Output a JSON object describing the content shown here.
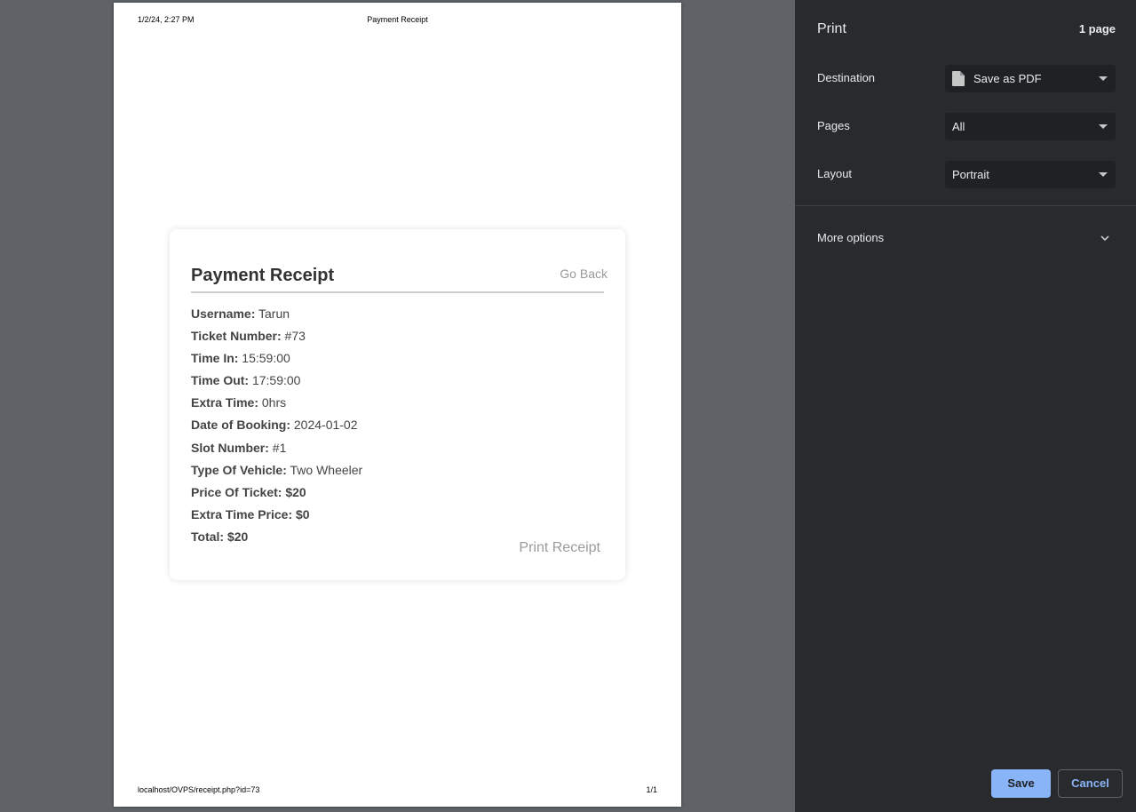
{
  "preview": {
    "header_date": "1/2/24, 2:27 PM",
    "header_title": "Payment Receipt",
    "footer_url": "localhost/OVPS/receipt.php?id=73",
    "footer_page": "1/1"
  },
  "receipt": {
    "title": "Payment Receipt",
    "go_back": "Go Back",
    "print_receipt": "Print Receipt",
    "fields": [
      {
        "label": "Username:",
        "value": " Tarun"
      },
      {
        "label": "Ticket Number:",
        "value": " #73"
      },
      {
        "label": "Time In:",
        "value": " 15:59:00"
      },
      {
        "label": "Time Out:",
        "value": " 17:59:00"
      },
      {
        "label": "Extra Time:",
        "value": " 0hrs"
      },
      {
        "label": "Date of Booking:",
        "value": " 2024-01-02"
      },
      {
        "label": "Slot Number:",
        "value": " #1"
      },
      {
        "label": "Type Of Vehicle:",
        "value": " Two Wheeler"
      },
      {
        "label": "Price Of Ticket: $20",
        "value": ""
      },
      {
        "label": "Extra Time Price: $0",
        "value": ""
      },
      {
        "label": "Total: $20",
        "value": ""
      }
    ]
  },
  "print_panel": {
    "title": "Print",
    "page_count": "1 page",
    "destination_label": "Destination",
    "destination_value": "Save as PDF",
    "pages_label": "Pages",
    "pages_value": "All",
    "layout_label": "Layout",
    "layout_value": "Portrait",
    "more_options": "More options",
    "save": "Save",
    "cancel": "Cancel",
    "accent_color": "#8ab4f8",
    "background_color": "#292a2d"
  }
}
